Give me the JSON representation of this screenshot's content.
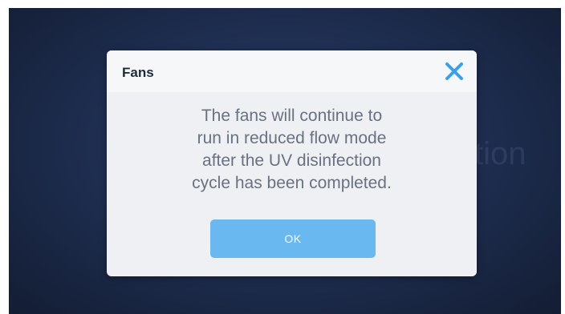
{
  "dialog": {
    "title": "Fans",
    "message_lines": [
      "The fans will continue to",
      "run in reduced flow mode",
      "after the UV disinfection",
      "cycle has been completed."
    ],
    "ok_label": "OK",
    "close_icon": "close-icon"
  },
  "background": {
    "ghost_text_1": "",
    "ghost_text_2": "tion",
    "ghost_text_3": ""
  },
  "colors": {
    "screen_bg": "#1d2c4d",
    "dialog_bg": "#eef0f3",
    "accent_close": "#3aa0e8",
    "ok_button": "#6ab8f0",
    "message_text": "#6a7180",
    "title_text": "#1e2a3c"
  }
}
